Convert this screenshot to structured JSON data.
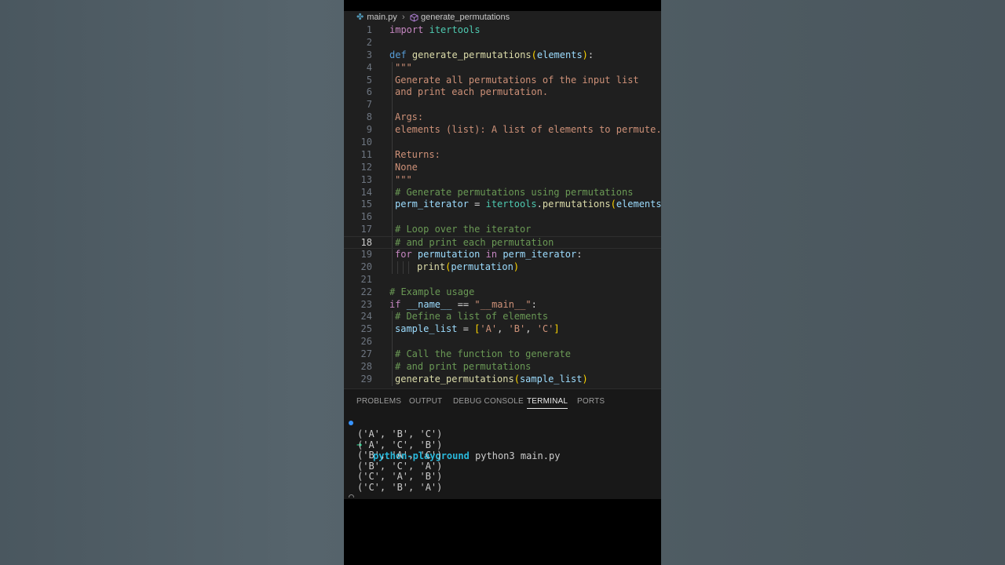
{
  "breadcrumb": {
    "file": "main.py",
    "symbol": "generate_permutations"
  },
  "editor": {
    "current_line": 18,
    "lines": [
      {
        "n": "1"
      },
      {
        "n": "2"
      },
      {
        "n": "3"
      },
      {
        "n": "4"
      },
      {
        "n": "5"
      },
      {
        "n": "6"
      },
      {
        "n": "7"
      },
      {
        "n": "8"
      },
      {
        "n": "9"
      },
      {
        "n": "10"
      },
      {
        "n": "11"
      },
      {
        "n": "12"
      },
      {
        "n": "13"
      },
      {
        "n": "14"
      },
      {
        "n": "15"
      },
      {
        "n": "16"
      },
      {
        "n": "17"
      },
      {
        "n": "18"
      },
      {
        "n": "19"
      },
      {
        "n": "20"
      },
      {
        "n": "21"
      },
      {
        "n": "22"
      },
      {
        "n": "23"
      },
      {
        "n": "24"
      },
      {
        "n": "25"
      },
      {
        "n": "26"
      },
      {
        "n": "27"
      },
      {
        "n": "28"
      },
      {
        "n": "29"
      }
    ],
    "code": {
      "l1_kw": "import",
      "l1_mod": "itertools",
      "l3_kw": "def",
      "l3_fn": "generate_permutations",
      "l3_param": "elements",
      "l4": "\"\"\"",
      "l5": "Generate all permutations of the input list",
      "l6": "and print each permutation.",
      "l8": "Args:",
      "l9": "elements (list): A list of elements to permute.",
      "l11": "Returns:",
      "l12": "None",
      "l13": "\"\"\"",
      "l14": "# Generate permutations using permutations",
      "l15_var": "perm_iterator",
      "l15_mod": "itertools",
      "l15_fn": "permutations",
      "l15_arg": "elements",
      "l17": "# Loop over the iterator",
      "l18": "# and print each permutation",
      "l19_kw": "for",
      "l19_var": "permutation",
      "l19_in": "in",
      "l19_iter": "perm_iterator",
      "l20_fn": "print",
      "l20_arg": "permutation",
      "l22": "# Example usage",
      "l23_kw": "if",
      "l23_name": "__name__",
      "l23_str": "\"__main__\"",
      "l24": "# Define a list of elements",
      "l25_var": "sample_list",
      "l25_a": "'A'",
      "l25_b": "'B'",
      "l25_c": "'C'",
      "l27": "# Call the function to generate",
      "l28": "# and print permutations",
      "l29_fn": "generate_permutations",
      "l29_arg": "sample_list"
    }
  },
  "panel": {
    "tabs": [
      "PROBLEMS",
      "OUTPUT",
      "DEBUG CONSOLE",
      "TERMINAL",
      "PORTS"
    ],
    "active_tab": "TERMINAL"
  },
  "terminal": {
    "prompt_dir": "python-playground",
    "command": "python3 main.py",
    "output": [
      "('A', 'B', 'C')",
      "('A', 'C', 'B')",
      "('B', 'A', 'C')",
      "('B', 'C', 'A')",
      "('C', 'A', 'B')",
      "('C', 'B', 'A')"
    ],
    "arrow": "➜"
  },
  "colors": {
    "editor_bg": "#1f1f1f",
    "panel_bg": "#181818",
    "keyword": "#569cd6",
    "function": "#dcdcaa",
    "variable": "#9cdcfe",
    "string": "#ce9178",
    "comment": "#6a9955",
    "terminal_project": "#29b8db"
  }
}
